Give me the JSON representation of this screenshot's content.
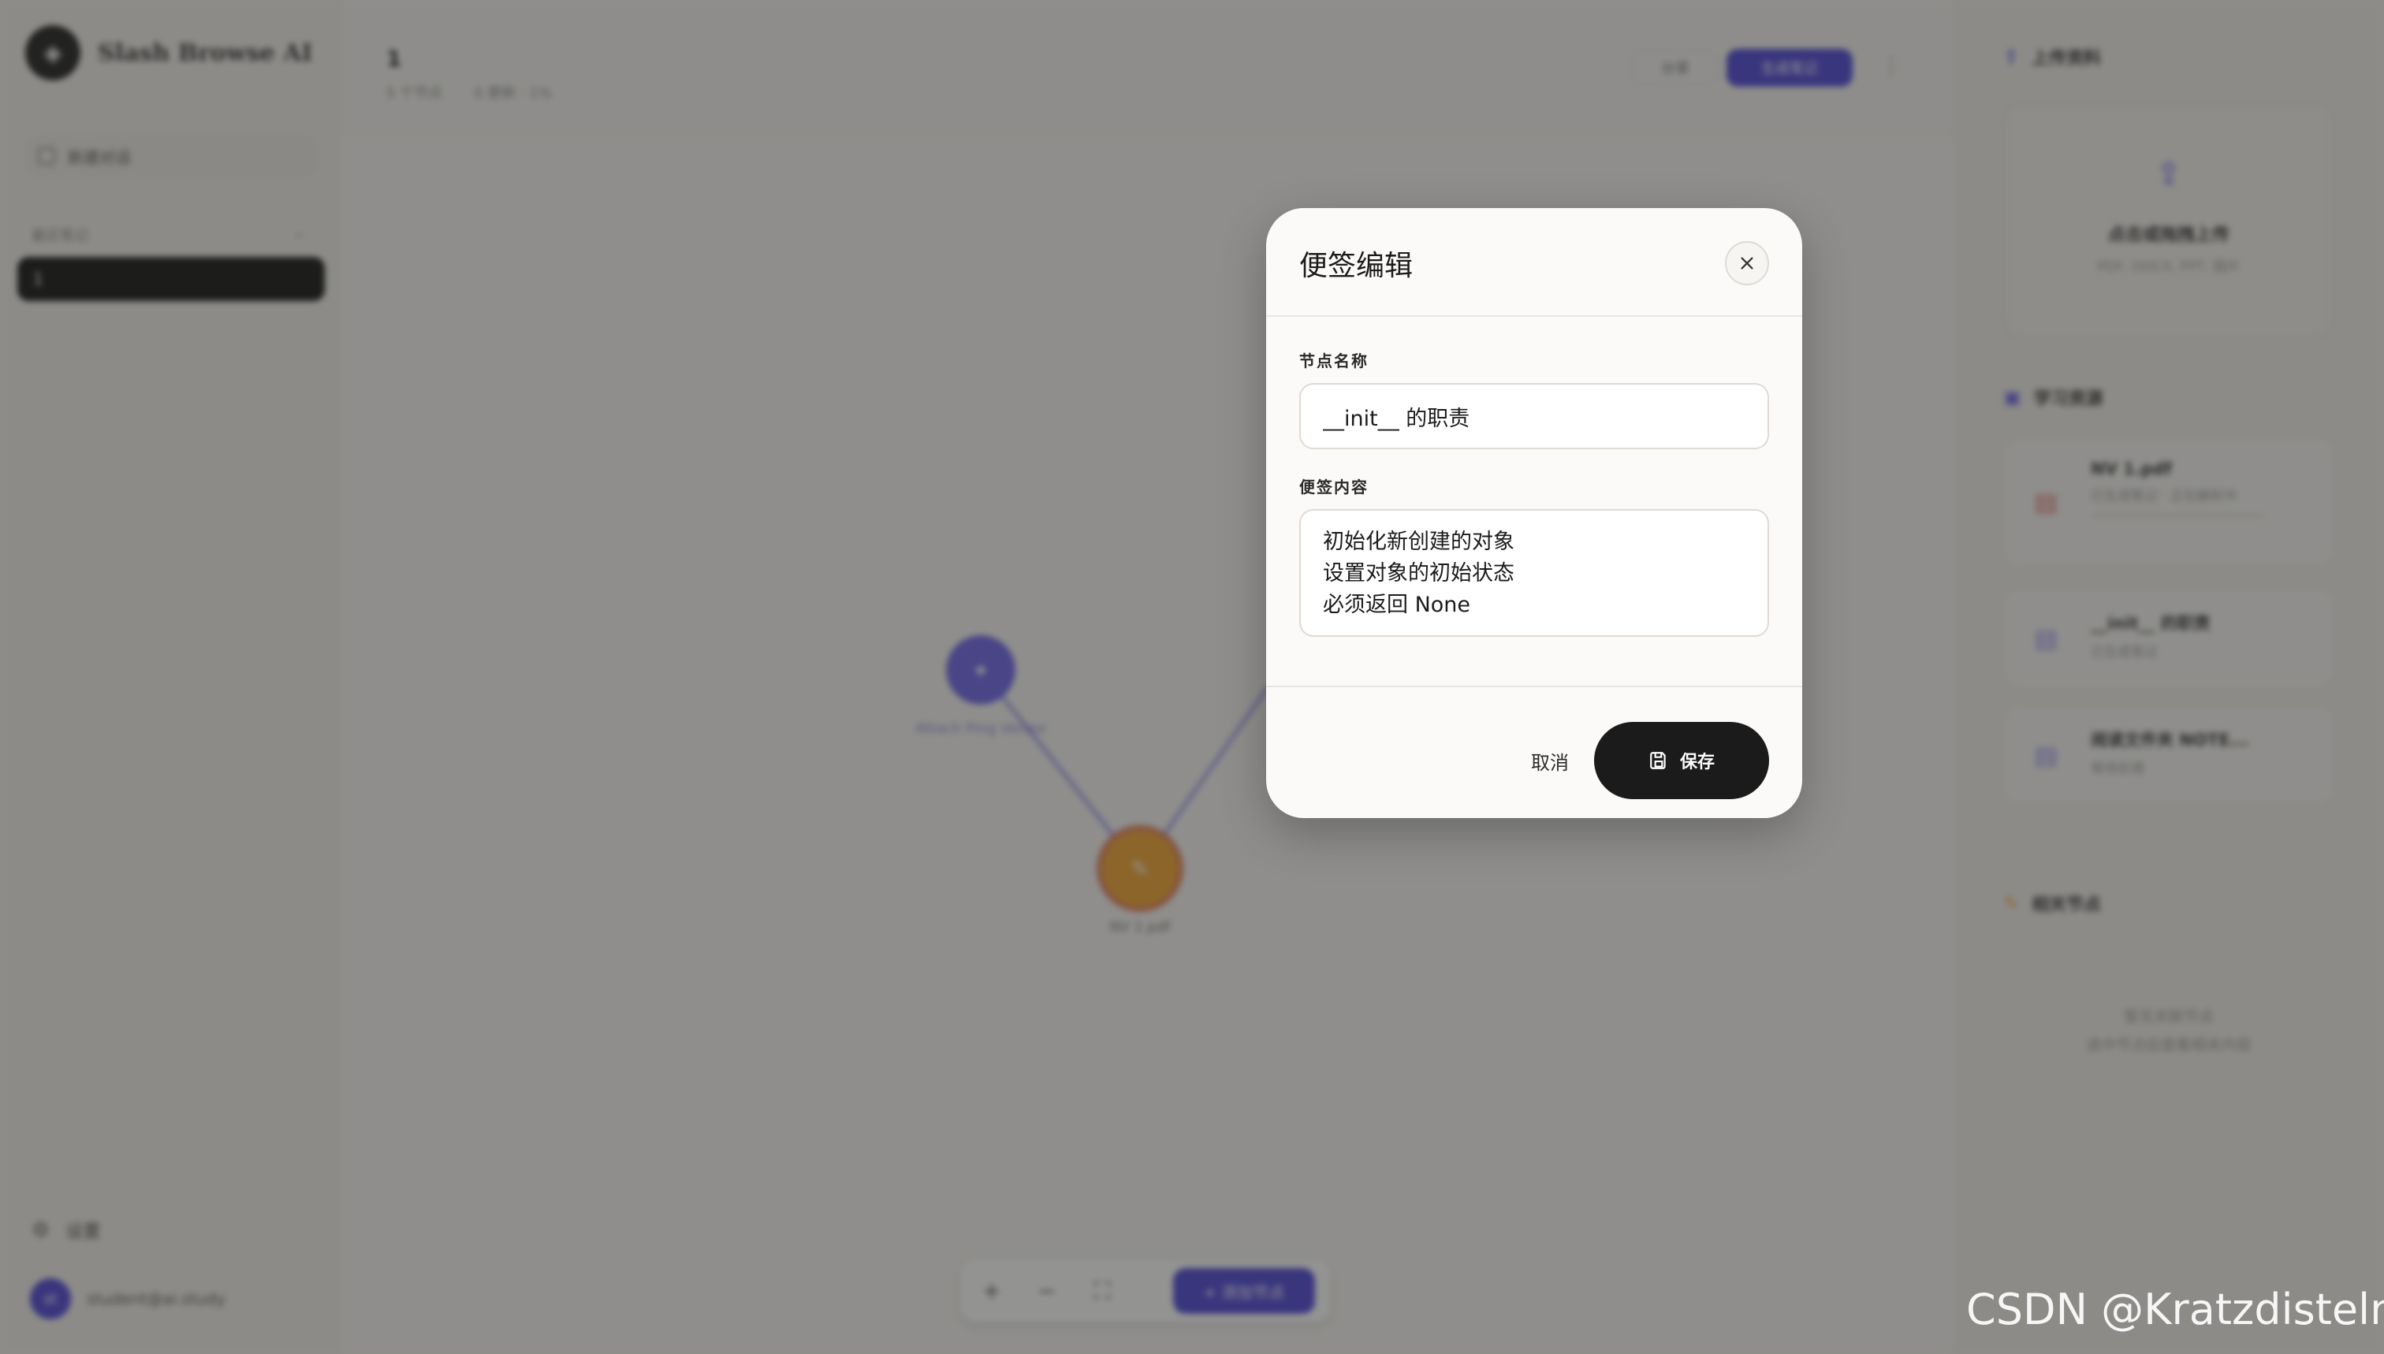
{
  "app": {
    "brand": "Slash Browse AI",
    "new_note": "新建对话",
    "section_label": "最近笔记",
    "active_item": "1",
    "settings": "设置",
    "user_initials": "st",
    "user_email": "student@ai.study"
  },
  "header": {
    "title": "1",
    "meta_nodes": "5 个节点",
    "meta_updated": "0 更新 · 1%",
    "outline_btn": "分享",
    "primary_btn": "生成笔记"
  },
  "graph": {
    "node_top_label": "Attach Ping Vertex",
    "node_bottom_label": "NV 1.pdf",
    "node_top_glyph": "✦",
    "node_bottom_glyph": "✎"
  },
  "toolbar": {
    "zoom_in": "+",
    "zoom_out": "−",
    "fit": "⛶",
    "add_node": "+ 添加节点"
  },
  "rightpanel": {
    "upload_heading": "上传资料",
    "upload_title": "点击或拖拽上传",
    "upload_hint": "PDF, DOCX, PPT, 图片",
    "study_heading": "学习资源",
    "file1_title": "NV 1.pdf",
    "file1_sub": "已生成笔记 · 正在解析中",
    "file2_title": "__init__ 的职责",
    "file2_sub": "已生成笔记",
    "file3_title": "阅读文件夹 NOTE...",
    "file3_sub": "等待处理",
    "related_heading": "相关节点",
    "empty_line1": "暂无关联节点",
    "empty_line2": "选中节点后查看相关内容"
  },
  "modal": {
    "title": "便签编辑",
    "name_label": "节点名称",
    "name_value": "__init__ 的职责",
    "content_label": "便签内容",
    "content_value": "初始化新创建的对象\n设置对象的初始状态\n必须返回 None",
    "cancel": "取消",
    "save": "保存"
  },
  "watermark": "CSDN @Kratzdisteln",
  "colors": {
    "accent": "#4b44d6",
    "dark_button": "#1b1b1b",
    "node_purple": "#6b63e8",
    "node_orange": "#f0a330",
    "overlay": "rgba(40,40,38,0.5)"
  }
}
